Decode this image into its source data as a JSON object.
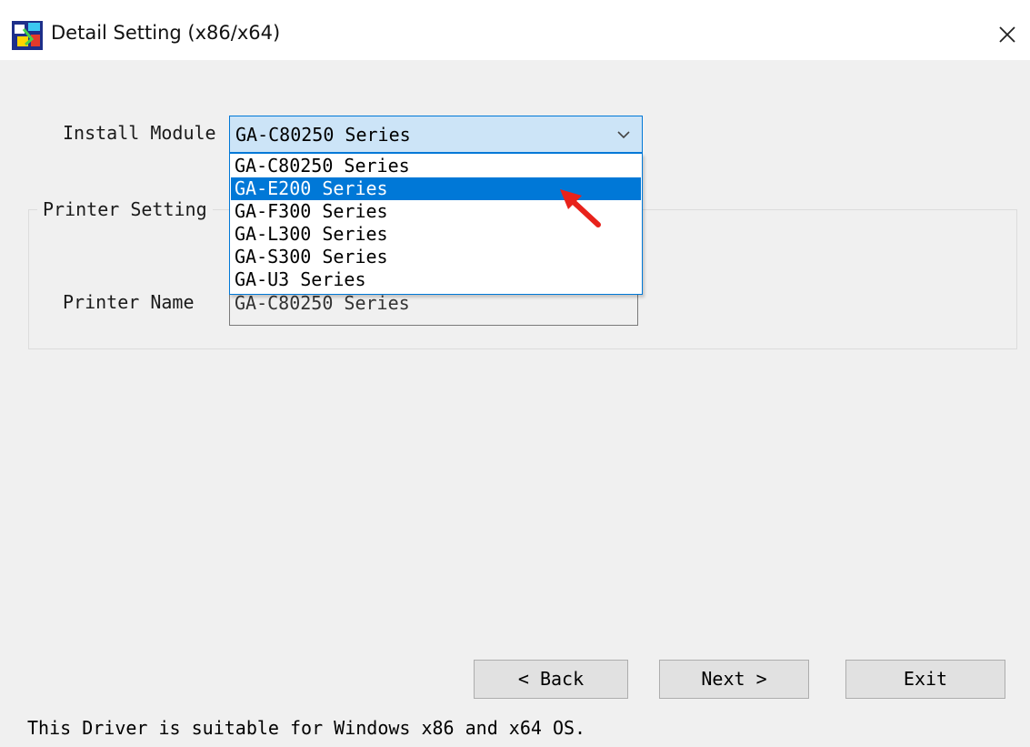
{
  "window": {
    "title": "Detail Setting (x86/x64)"
  },
  "install_module": {
    "label": "Install Module",
    "selected": "GA-C80250 Series",
    "options": [
      "GA-C80250 Series",
      "GA-E200 Series",
      "GA-F300 Series",
      "GA-L300 Series",
      "GA-S300 Series",
      "GA-U3 Series"
    ],
    "highlighted_index": 1
  },
  "printer_setting": {
    "group_label": "Printer Setting",
    "name_label": "Printer Name",
    "name_value": "GA-C80250 Series"
  },
  "buttons": {
    "back": "< Back",
    "next": "Next >",
    "exit": "Exit"
  },
  "footer": {
    "note": "This Driver is suitable for Windows x86 and x64 OS."
  },
  "colors": {
    "accent": "#0078d7",
    "combo_bg": "#cce4f7",
    "pointer": "#e8221b"
  },
  "icons": {
    "app": "printer-driver-app-icon",
    "close": "close-icon",
    "dropdown": "chevron-down-icon",
    "annotation": "red-pointer-arrow-icon"
  }
}
